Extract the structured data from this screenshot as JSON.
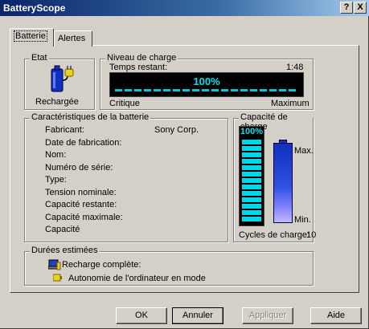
{
  "window": {
    "title": "BatteryScope",
    "help_button": "?",
    "close_button": "X"
  },
  "tabs": [
    "Batterie",
    "Alertes"
  ],
  "etat": {
    "legend": "Etat",
    "status": "Rechargée"
  },
  "niveau": {
    "legend": "Niveau de charge",
    "time_label": "Temps restant:",
    "time_value": "1:48",
    "percent_text": "100%",
    "charge_fraction": 1.0,
    "min_label": "Critique",
    "max_label": "Maximum"
  },
  "caracteristiques": {
    "legend": "Caractéristiques de la batterie",
    "rows": [
      {
        "label": "Fabricant:",
        "value": "Sony Corp."
      },
      {
        "label": "Date de fabrication:",
        "value": ""
      },
      {
        "label": "Nom:",
        "value": ""
      },
      {
        "label": "Numéro de série:",
        "value": ""
      },
      {
        "label": "Type:",
        "value": ""
      },
      {
        "label": "Tension nominale:",
        "value": ""
      },
      {
        "label": "Capacité restante:",
        "value": ""
      },
      {
        "label": "Capacité maximale:",
        "value": ""
      },
      {
        "label": "Capacité",
        "value": ""
      }
    ]
  },
  "capacite": {
    "legend": "Capacité de charge",
    "percent_text": "100%",
    "capacity_fraction": 1.0,
    "max_label": "Max.",
    "min_label": "Min.",
    "cycles_label": "Cycles de charge:",
    "cycles_value": "10"
  },
  "durees": {
    "legend": "Durées estimées",
    "recharge_label": "Recharge complète:",
    "autonomie_label": "Autonomie de l'ordinateur en mode"
  },
  "buttons": {
    "ok": "OK",
    "annuler": "Annuler",
    "appliquer": "Appliquer",
    "aide": "Aide"
  },
  "colors": {
    "titlebar": "#0a246a",
    "lcd_text": "#00e0f0",
    "battery_blue": "#1030c0"
  }
}
